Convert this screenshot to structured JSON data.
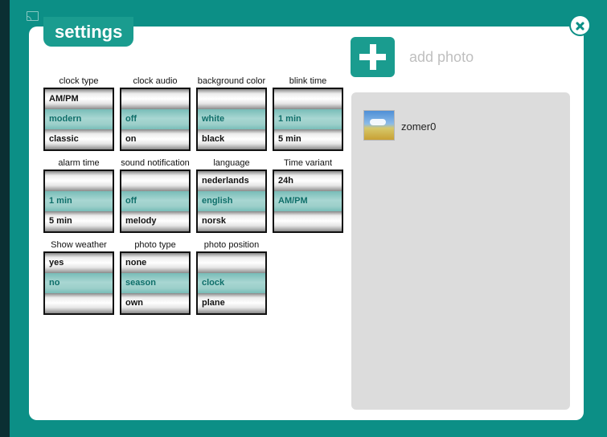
{
  "header": {
    "title": "settings"
  },
  "add_photo": {
    "label": "add photo"
  },
  "photos": [
    {
      "name": "zomer0"
    }
  ],
  "settings": [
    {
      "label": "clock type",
      "options": [
        "AM/PM",
        "modern",
        "classic"
      ]
    },
    {
      "label": "clock audio",
      "options": [
        "",
        "off",
        "on"
      ]
    },
    {
      "label": "background color",
      "options": [
        "",
        "white",
        "black"
      ]
    },
    {
      "label": "blink time",
      "options": [
        "",
        "1 min",
        "5 min"
      ]
    },
    {
      "label": "alarm time",
      "options": [
        "",
        "1 min",
        "5 min"
      ]
    },
    {
      "label": "sound notification",
      "options": [
        "",
        "off",
        "melody"
      ]
    },
    {
      "label": "language",
      "options": [
        "nederlands",
        "english",
        "norsk"
      ]
    },
    {
      "label": "Time variant",
      "options": [
        "24h",
        "AM/PM",
        ""
      ]
    },
    {
      "label": "Show weather",
      "options": [
        "yes",
        "no",
        ""
      ]
    },
    {
      "label": "photo type",
      "options": [
        "none",
        "season",
        "own"
      ]
    },
    {
      "label": "photo position",
      "options": [
        "",
        "clock",
        "plane"
      ]
    }
  ],
  "colors": {
    "accent": "#0c8f86",
    "tab": "#1a9c8f",
    "selected_row": "#a8d6d2",
    "selected_text": "#0e6e69",
    "dark_strip": "#0b2f33"
  },
  "icons": {
    "close": "close-icon",
    "add": "plus-icon",
    "cast": "cast-icon"
  }
}
